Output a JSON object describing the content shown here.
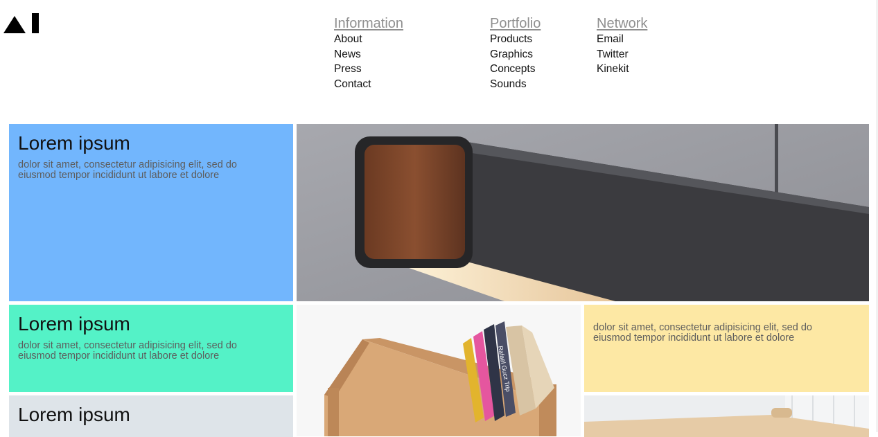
{
  "logo": {
    "text": "AI"
  },
  "nav": {
    "columns": [
      {
        "heading": "Information",
        "links": [
          "About",
          "News",
          "Press",
          "Contact"
        ]
      },
      {
        "heading": "Portfolio",
        "links": [
          "Products",
          "Graphics",
          "Concepts",
          "Sounds"
        ]
      },
      {
        "heading": "Network",
        "links": [
          "Email",
          "Twitter",
          "Kinekit"
        ]
      }
    ]
  },
  "tiles": {
    "blue": {
      "title": "Lorem ipsum",
      "body": "dolor sit amet, consectetur adipisicing elit, sed do eiusmod tempor incididunt ut labore et dolore",
      "color": "#72b6fd"
    },
    "green": {
      "title": "Lorem ipsum",
      "body": "dolor sit amet, consectetur adipisicing elit, sed do eiusmod tempor incididunt ut labore et dolore",
      "color": "#54f2c7"
    },
    "grey": {
      "title": "Lorem ipsum",
      "color": "#dee4e9"
    },
    "yellow": {
      "body": "dolor sit amet, consectetur adipisicing elit, sed do eiusmod tempor incididunt ut labore et dolore",
      "color": "#fde8a4"
    }
  },
  "images": {
    "lamp": {
      "icon": "pendant-lamp-photo"
    },
    "shelf": {
      "icon": "book-shelf-photo",
      "book_spine_text": "Rafaël Gucz Trip"
    },
    "table": {
      "icon": "wooden-table-photo"
    }
  }
}
